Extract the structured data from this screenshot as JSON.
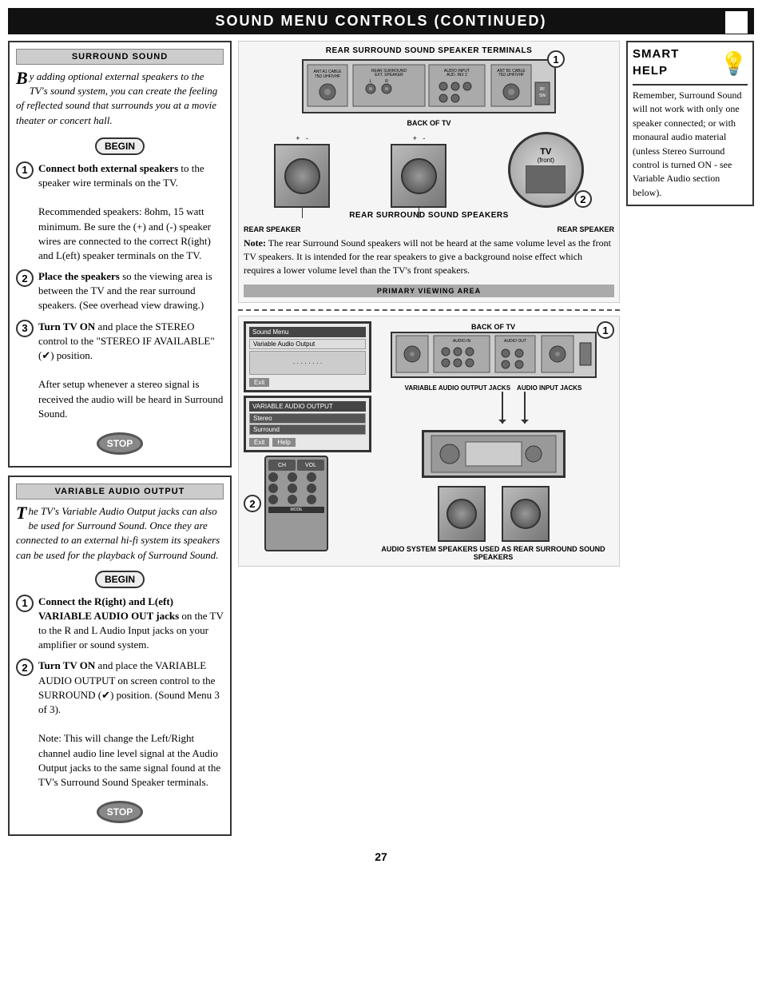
{
  "title": "Sound Menu Controls (Continued)",
  "corner_box": "",
  "surround_section": {
    "header": "Surround Sound",
    "intro": "y adding optional external speakers to the TV's sound system, you can create the feeling of reflected sound that surrounds you at a movie theater or concert hall.",
    "intro_first_letter": "B",
    "begin_label": "BEGIN",
    "steps": [
      {
        "num": "1",
        "bold": "Connect both external speakers",
        "rest": " to the speaker wire terminals on the TV.\n\nRecommended speakers: 8ohm, 15 watt minimum. Be sure the (+) and (-) speaker wires are connected to the correct R(ight) and L(eft) speaker terminals on the TV."
      },
      {
        "num": "2",
        "bold": "Place the speakers",
        "rest": " so the viewing area is between the TV and the rear surround speakers. (See overhead view drawing.)"
      },
      {
        "num": "3",
        "bold": "Turn TV ON",
        "rest": " and place the STEREO control to the \"STEREO IF AVAILABLE\" (✔) position.\n\nAfter setup whenever a stereo signal is received the audio will be heard in Surround Sound."
      }
    ],
    "stop_label": "STOP"
  },
  "variable_section": {
    "header": "Variable Audio Output",
    "intro": "he TV's Variable Audio Output jacks can also be used for Surround Sound. Once they are connected to an external hi-fi system its speakers can be used for the playback of Surround Sound.",
    "intro_first_letter": "T",
    "begin_label": "BEGIN",
    "steps": [
      {
        "num": "1",
        "bold": "Connect the R(ight) and L(eft) VARIABLE AUDIO OUT jacks",
        "rest": " on the TV to the R and L Audio Input jacks on your amplifier or sound system."
      },
      {
        "num": "2",
        "bold": "Turn TV ON",
        "rest": " and place the VARIABLE AUDIO OUTPUT on screen control to the SURROUND (✔) position. (Sound Menu 3 of 3).\n\nNote: This will change the Left/Right channel audio line level signal at the Audio Output jacks to the same signal found at the TV's Surround Sound Speaker terminals."
      }
    ],
    "stop_label": "STOP"
  },
  "smart_help": {
    "title_line1": "Smart",
    "title_line2": "Help",
    "bulb": "💡",
    "text": "Remember, Surround Sound will not work with only one speaker connected; or with monaural audio material (unless Stereo Surround control is turned ON - see Variable Audio section below)."
  },
  "diagrams": {
    "top": {
      "terminal_label": "Rear Surround Sound Speaker Terminals",
      "back_of_tv": "Back of TV",
      "speaker_note_bold": "Note:",
      "speaker_note": " The rear Surround Sound speakers will not be heard at the same volume level as the front TV speakers. It is intended for the rear speakers to give a background noise effect which requires a lower volume level than the TV's front speakers.",
      "rear_speaker_label": "Rear Speaker",
      "rear_speaker_label2": "Rear Speaker",
      "viewing_label": "Primary Viewing Area",
      "step1_label": "1",
      "step2_label": "2"
    },
    "bottom": {
      "back_of_tv": "Back of TV",
      "var_audio_label": "Variable Audio Output Jacks",
      "audio_input_label": "Audio Input Jacks",
      "audio_sys_label": "Audio System Speakers Used As Rear Surround Sound Speakers",
      "step1_label": "1",
      "step2_label": "2",
      "menu_title": "Sound Menu",
      "menu_item1": "Variable Audio Output",
      "menu_item2": "Stereo",
      "menu_item3": "Surround",
      "exit_label": "Exit",
      "help_label": "Help"
    }
  },
  "page_number": "27"
}
